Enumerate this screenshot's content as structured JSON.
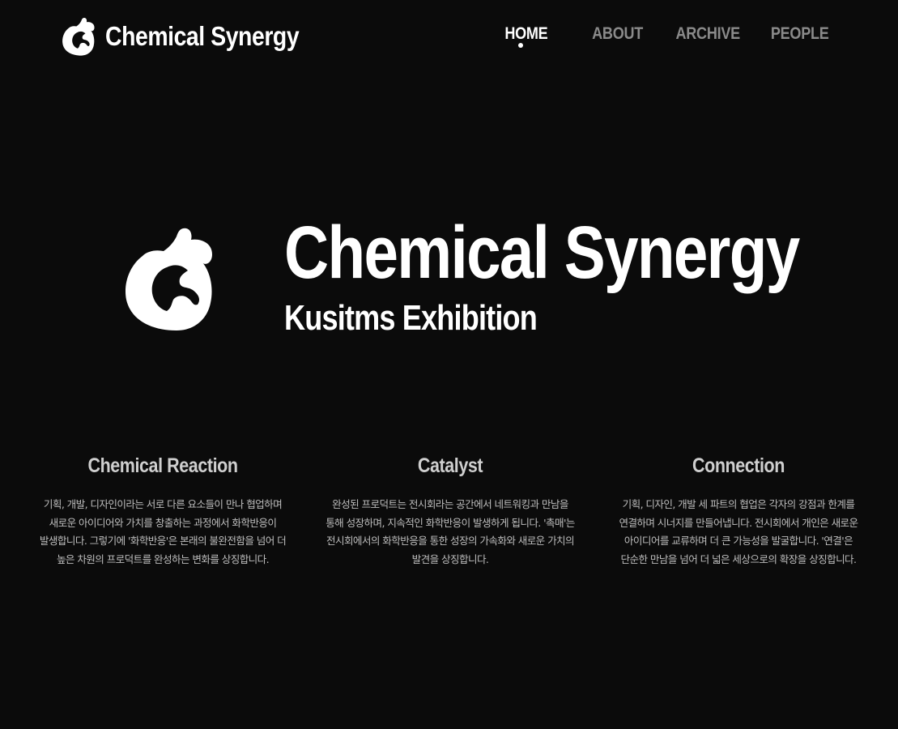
{
  "header": {
    "brand_name": "Chemical Synergy",
    "logo_icon": "chemical-splash-logo"
  },
  "nav": {
    "items": [
      {
        "label": "HOME",
        "active": true
      },
      {
        "label": "ABOUT",
        "active": false
      },
      {
        "label": "ARCHIVE",
        "active": false
      },
      {
        "label": "PEOPLE",
        "active": false
      }
    ]
  },
  "hero": {
    "title": "Chemical Synergy",
    "subtitle": "Kusitms Exhibition"
  },
  "features": [
    {
      "title": "Chemical Reaction",
      "description": "기획, 개발, 디자인이라는 서로 다른 요소들이 만나 협업하며 새로운 아이디어와 가치를 창출하는 과정에서 화학반응이 발생합니다. 그렇기에 '화학반응'은 본래의 불완전함을 넘어 더 높은 차원의 프로덕트를 완성하는 변화를 상징합니다."
    },
    {
      "title": "Catalyst",
      "description": "완성된 프로덕트는 전시회라는 공간에서 네트워킹과 만남을 통해 성장하며, 지속적인 화학반응이 발생하게 됩니다. '촉매'는 전시회에서의 화학반응을 통한 성장의 가속화와 새로운 가치의 발견을 상징합니다."
    },
    {
      "title": "Connection",
      "description": "기획, 디자인, 개발 세 파트의 협업은 각자의 강점과 한계를 연결하며 시너지를 만들어냅니다. 전시회에서 개인은 새로운 아이디어를 교류하며 더 큰 가능성을 발굴합니다. '연결'은 단순한 만남을 넘어 더 넓은 세상으로의 확장을 상징합니다."
    }
  ],
  "colors": {
    "background": "#0b0b0b",
    "text_primary": "#ffffff",
    "nav_inactive": "#8a8a8a",
    "feature_title": "#cfcfcf",
    "feature_text": "#bdbdbd"
  }
}
